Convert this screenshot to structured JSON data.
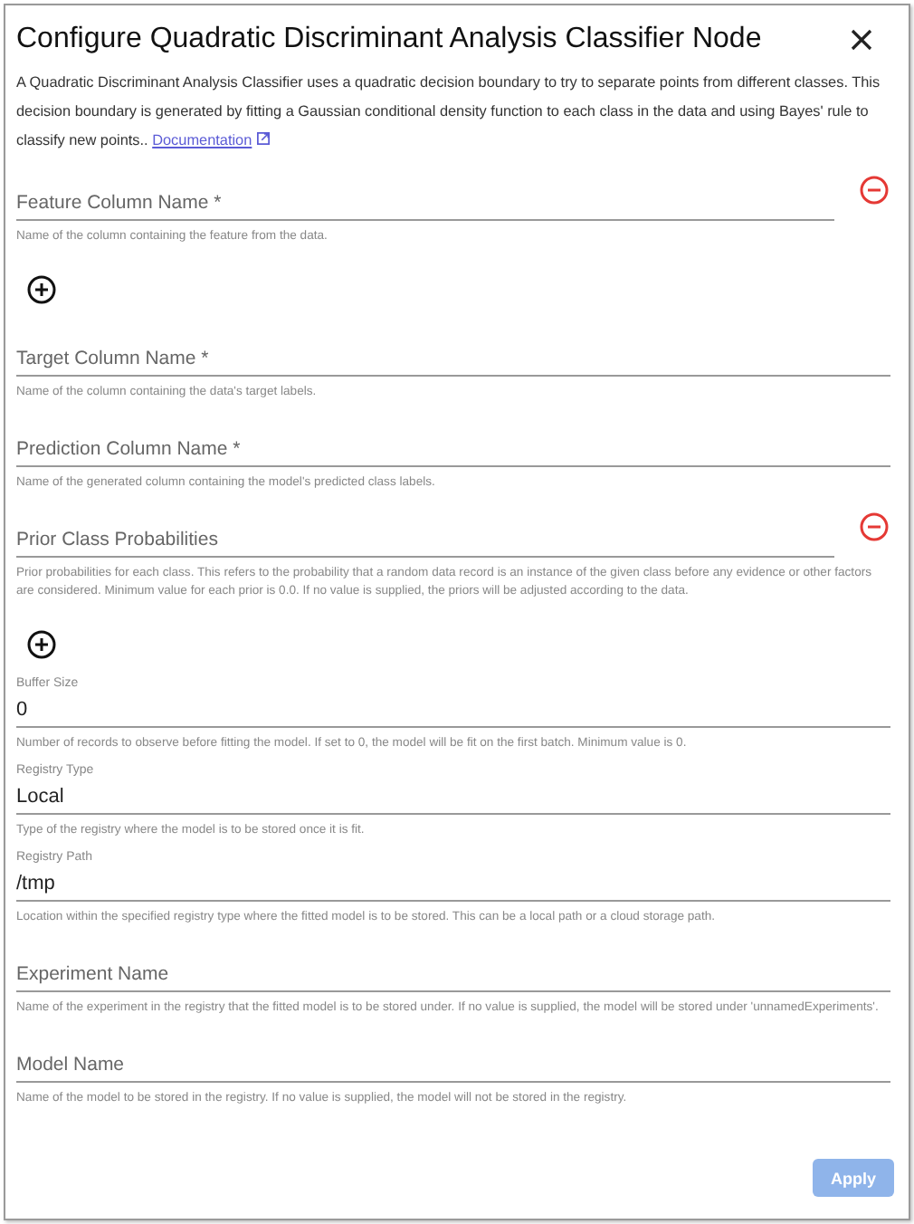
{
  "dialog": {
    "title": "Configure Quadratic Discriminant Analysis Classifier Node",
    "description": "A Quadratic Discriminant Analysis Classifier uses a quadratic decision boundary to try to separate points from different classes. This decision boundary is generated by fitting a Gaussian conditional density function to each class in the data and using Bayes' rule to classify new points..",
    "link": "Documentation"
  },
  "fields": [
    {
      "kind": "list",
      "placeholder": "Feature Column Name *",
      "help": "Name of the column containing the feature from the data."
    },
    {
      "kind": "text",
      "placeholder": "Target Column Name *",
      "help": "Name of the column containing the data's target labels."
    },
    {
      "kind": "text",
      "placeholder": "Prediction Column Name *",
      "help": "Name of the generated column containing the model's predicted class labels."
    },
    {
      "kind": "list",
      "placeholder": "Prior Class Probabilities",
      "help": "Prior probabilities for each class. This refers to the probability that a random data record is an instance of the given class before any evidence or other factors are considered. Minimum value for each prior is 0.0. If no value is supplied, the priors will be adjusted according to the data."
    },
    {
      "kind": "filled",
      "label": "Buffer Size",
      "value": "0",
      "help": "Number of records to observe before fitting the model. If set to 0, the model will be fit on the first batch. Minimum value is 0."
    },
    {
      "kind": "filled",
      "label": "Registry Type",
      "value": "Local",
      "help": "Type of the registry where the model is to be stored once it is fit."
    },
    {
      "kind": "filled",
      "label": "Registry Path",
      "value": "/tmp",
      "help": "Location within the specified registry type where the fitted model is to be stored. This can be a local path or a cloud storage path."
    },
    {
      "kind": "text",
      "placeholder": "Experiment Name",
      "help": "Name of the experiment in the registry that the fitted model is to be stored under. If no value is supplied, the model will be stored under 'unnamedExperiments'."
    },
    {
      "kind": "text",
      "placeholder": "Model Name",
      "help": "Name of the model to be stored in the registry. If no value is supplied, the model will not be stored in the registry."
    }
  ],
  "apply": {
    "label": "Apply",
    "disabled": true
  }
}
